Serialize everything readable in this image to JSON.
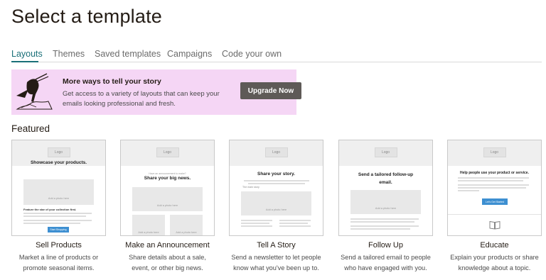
{
  "page": {
    "title": "Select a template"
  },
  "tabs": [
    {
      "label": "Layouts",
      "active": true
    },
    {
      "label": "Themes",
      "active": false
    },
    {
      "label": "Saved templates",
      "active": false
    },
    {
      "label": "Campaigns",
      "active": false
    },
    {
      "label": "Code your own",
      "active": false
    }
  ],
  "promo": {
    "title": "More ways to tell your story",
    "text": "Get access to a variety of layouts that can keep your emails looking professional and fresh.",
    "button_label": "Upgrade Now",
    "background": "#f5d6f5"
  },
  "featured": {
    "label": "Featured",
    "cards": [
      {
        "title": "Sell Products",
        "description": "Market a line of products or promote seasonal items.",
        "thumb": {
          "logo": "Logo",
          "heading": "Showcase your products.",
          "photo_label": "Add a photo here",
          "body_title": "Feature the star of your collection first.",
          "button_label": "Start Shopping"
        }
      },
      {
        "title": "Make an Announcement",
        "description": "Share details about a sale, event, or other big news.",
        "thumb": {
          "logo": "Logo",
          "subheading": "Have an announcement to make?",
          "heading": "Share your big news.",
          "photo_label": "Add a photo here",
          "photo_label_left": "Add a photo here",
          "photo_label_right": "Add a photo here"
        }
      },
      {
        "title": "Tell A Story",
        "description": "Send a newsletter to let people know what you've been up to.",
        "thumb": {
          "logo": "Logo",
          "heading": "Share your story.",
          "story_label": "The main story",
          "photo_label": "Add a photo here"
        }
      },
      {
        "title": "Follow Up",
        "description": "Send a tailored email to people who have engaged with you.",
        "thumb": {
          "logo": "Logo",
          "heading": "Send a tailored follow-up email.",
          "photo_label": "Add a photo here"
        }
      },
      {
        "title": "Educate",
        "description": "Explain your products or share knowledge about a topic.",
        "thumb": {
          "logo": "Logo",
          "heading": "Help people use your product or service.",
          "button_label": "Let's Get Started"
        }
      }
    ]
  },
  "colors": {
    "accent": "#1a6f78",
    "text": "#241c15",
    "promo_button": "#5e5a57",
    "thumb_button": "#3d8fd1"
  }
}
